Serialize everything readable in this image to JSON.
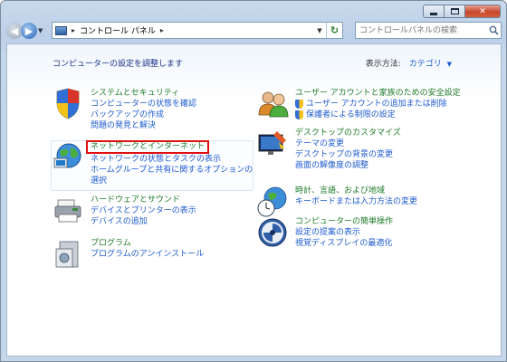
{
  "window": {
    "colors": {
      "accent": "#1e5bd0",
      "category_title": "#1e7a28",
      "highlight_border": "#e01010"
    }
  },
  "nav": {
    "back_icon": "back-arrow-icon",
    "forward_icon": "forward-arrow-icon",
    "address_sep1": "▸",
    "address_path": "コントロール パネル",
    "address_sep2": "▸",
    "search_placeholder": "コントロールパネルの検索"
  },
  "content": {
    "title": "コンピューターの設定を調整します",
    "view_by_label": "表示方法:",
    "view_by_value": "カテゴリ"
  },
  "categories": {
    "system": {
      "icon": "shield-icon",
      "title": "システムとセキュリティ",
      "links": [
        "コンピューターの状態を確認",
        "バックアップの作成",
        "問題の発見と解決"
      ]
    },
    "network": {
      "icon": "network-globe-icon",
      "title": "ネットワークとインターネット",
      "links": [
        "ネットワークの状態とタスクの表示",
        "ホームグループと共有に関するオプションの",
        "選択"
      ]
    },
    "hardware": {
      "icon": "printer-icon",
      "title": "ハードウェアとサウンド",
      "links": [
        "デバイスとプリンターの表示",
        "デバイスの追加"
      ]
    },
    "programs": {
      "icon": "programs-icon",
      "title": "プログラム",
      "links": [
        "プログラムのアンインストール"
      ]
    },
    "users": {
      "icon": "users-icon",
      "title": "ユーザー アカウントと家族のための安全設定",
      "links": [
        "ユーザー アカウントの追加または削除",
        "保護者による制限の設定"
      ]
    },
    "appearance": {
      "icon": "appearance-icon",
      "title": "デスクトップのカスタマイズ",
      "links": [
        "テーマの変更",
        "デスクトップの背景の変更",
        "画面の解像度の調整"
      ]
    },
    "clock": {
      "icon": "globe-clock-icon",
      "title": "時計、言語、および地域",
      "links": [
        "キーボードまたは入力方法の変更"
      ]
    },
    "ease": {
      "icon": "ease-of-access-icon",
      "title": "コンピューターの簡単操作",
      "links": [
        "設定の提案の表示",
        "視覚ディスプレイの最適化"
      ]
    }
  }
}
